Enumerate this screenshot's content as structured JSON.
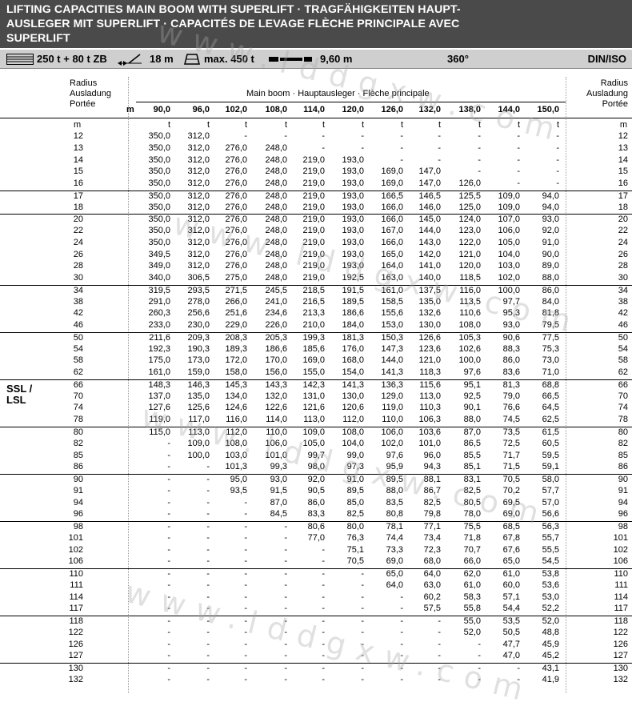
{
  "title": {
    "line1": "LIFTING CAPACITIES MAIN BOOM WITH SUPERLIFT · TRAGFÄHIGKEITEN HAUPT-",
    "line2": "AUSLEGER MIT SUPERLIFT · CAPACITÉS DE LEVAGE FLÈCHE PRINCIPALE AVEC",
    "line3": "SUPERLIFT"
  },
  "specs": {
    "counterweight": "250 t + 80 t ZB",
    "radius": "18 m",
    "max_load": "max. 450 t",
    "track": "9,60 m",
    "slew": "360°",
    "norm": "DIN/ISO"
  },
  "icons": [
    "counterweight-icon",
    "radius-icon",
    "hook-load-icon",
    "track-width-icon"
  ],
  "header": {
    "radius_left": [
      "Radius",
      "Ausladung",
      "Portée"
    ],
    "radius_right": [
      "Radius",
      "Ausladung",
      "Portée"
    ],
    "boom_label": "Main boom · Hauptausleger · Flèche principale",
    "m_label": "m",
    "unit_m": "m",
    "unit_t": "t"
  },
  "side_label": [
    "SSL /",
    "LSL"
  ],
  "columns": [
    "90,0",
    "96,0",
    "102,0",
    "108,0",
    "114,0",
    "120,0",
    "126,0",
    "132,0",
    "138,0",
    "144,0",
    "150,0"
  ],
  "rows": [
    {
      "r": "12",
      "v": [
        "350,0",
        "312,0",
        "-",
        "-",
        "-",
        "-",
        "-",
        "-",
        "-",
        "-",
        "-"
      ]
    },
    {
      "r": "13",
      "v": [
        "350,0",
        "312,0",
        "276,0",
        "248,0",
        "-",
        "-",
        "-",
        "-",
        "-",
        "-",
        "-"
      ]
    },
    {
      "r": "14",
      "v": [
        "350,0",
        "312,0",
        "276,0",
        "248,0",
        "219,0",
        "193,0",
        "-",
        "-",
        "-",
        "-",
        "-"
      ]
    },
    {
      "r": "15",
      "v": [
        "350,0",
        "312,0",
        "276,0",
        "248,0",
        "219,0",
        "193,0",
        "169,0",
        "147,0",
        "-",
        "-",
        "-"
      ]
    },
    {
      "r": "16",
      "v": [
        "350,0",
        "312,0",
        "276,0",
        "248,0",
        "219,0",
        "193,0",
        "169,0",
        "147,0",
        "126,0",
        "-",
        "-"
      ]
    },
    {
      "r": "17",
      "v": [
        "350,0",
        "312,0",
        "276,0",
        "248,0",
        "219,0",
        "193,0",
        "166,5",
        "146,5",
        "125,5",
        "109,0",
        "94,0"
      ]
    },
    {
      "r": "18",
      "v": [
        "350,0",
        "312,0",
        "276,0",
        "248,0",
        "219,0",
        "193,0",
        "166,0",
        "146,0",
        "125,0",
        "109,0",
        "94,0"
      ]
    },
    {
      "r": "20",
      "v": [
        "350,0",
        "312,0",
        "276,0",
        "248,0",
        "219,0",
        "193,0",
        "166,0",
        "145,0",
        "124,0",
        "107,0",
        "93,0"
      ]
    },
    {
      "r": "22",
      "v": [
        "350,0",
        "312,0",
        "276,0",
        "248,0",
        "219,0",
        "193,0",
        "167,0",
        "144,0",
        "123,0",
        "106,0",
        "92,0"
      ]
    },
    {
      "r": "24",
      "v": [
        "350,0",
        "312,0",
        "276,0",
        "248,0",
        "219,0",
        "193,0",
        "166,0",
        "143,0",
        "122,0",
        "105,0",
        "91,0"
      ]
    },
    {
      "r": "26",
      "v": [
        "349,5",
        "312,0",
        "276,0",
        "248,0",
        "219,0",
        "193,0",
        "165,0",
        "142,0",
        "121,0",
        "104,0",
        "90,0"
      ]
    },
    {
      "r": "28",
      "v": [
        "349,0",
        "312,0",
        "276,0",
        "248,0",
        "219,0",
        "193,0",
        "164,0",
        "141,0",
        "120,0",
        "103,0",
        "89,0"
      ]
    },
    {
      "r": "30",
      "v": [
        "340,0",
        "306,5",
        "275,0",
        "248,0",
        "219,0",
        "192,5",
        "163,0",
        "140,0",
        "118,5",
        "102,0",
        "88,0"
      ]
    },
    {
      "r": "34",
      "v": [
        "319,5",
        "293,5",
        "271,5",
        "245,5",
        "218,5",
        "191,5",
        "161,0",
        "137,5",
        "116,0",
        "100,0",
        "86,0"
      ]
    },
    {
      "r": "38",
      "v": [
        "291,0",
        "278,0",
        "266,0",
        "241,0",
        "216,5",
        "189,5",
        "158,5",
        "135,0",
        "113,5",
        "97,7",
        "84,0"
      ]
    },
    {
      "r": "42",
      "v": [
        "260,3",
        "256,6",
        "251,6",
        "234,6",
        "213,3",
        "186,6",
        "155,6",
        "132,6",
        "110,6",
        "95,3",
        "81,8"
      ]
    },
    {
      "r": "46",
      "v": [
        "233,0",
        "230,0",
        "229,0",
        "226,0",
        "210,0",
        "184,0",
        "153,0",
        "130,0",
        "108,0",
        "93,0",
        "79,5"
      ]
    },
    {
      "r": "50",
      "v": [
        "211,6",
        "209,3",
        "208,3",
        "205,3",
        "199,3",
        "181,3",
        "150,3",
        "126,6",
        "105,3",
        "90,6",
        "77,5"
      ]
    },
    {
      "r": "54",
      "v": [
        "192,3",
        "190,3",
        "189,3",
        "186,6",
        "185,6",
        "176,0",
        "147,3",
        "123,6",
        "102,6",
        "88,3",
        "75,3"
      ]
    },
    {
      "r": "58",
      "v": [
        "175,0",
        "173,0",
        "172,0",
        "170,0",
        "169,0",
        "168,0",
        "144,0",
        "121,0",
        "100,0",
        "86,0",
        "73,0"
      ]
    },
    {
      "r": "62",
      "v": [
        "161,0",
        "159,0",
        "158,0",
        "156,0",
        "155,0",
        "154,0",
        "141,3",
        "118,3",
        "97,6",
        "83,6",
        "71,0"
      ]
    },
    {
      "r": "66",
      "v": [
        "148,3",
        "146,3",
        "145,3",
        "143,3",
        "142,3",
        "141,3",
        "136,3",
        "115,6",
        "95,1",
        "81,3",
        "68,8"
      ]
    },
    {
      "r": "70",
      "v": [
        "137,0",
        "135,0",
        "134,0",
        "132,0",
        "131,0",
        "130,0",
        "129,0",
        "113,0",
        "92,5",
        "79,0",
        "66,5"
      ]
    },
    {
      "r": "74",
      "v": [
        "127,6",
        "125,6",
        "124,6",
        "122,6",
        "121,6",
        "120,6",
        "119,0",
        "110,3",
        "90,1",
        "76,6",
        "64,5"
      ]
    },
    {
      "r": "78",
      "v": [
        "119,0",
        "117,0",
        "116,0",
        "114,0",
        "113,0",
        "112,0",
        "110,0",
        "106,3",
        "88,0",
        "74,5",
        "62,5"
      ]
    },
    {
      "r": "80",
      "v": [
        "115,0",
        "113,0",
        "112,0",
        "110,0",
        "109,0",
        "108,0",
        "106,0",
        "103,6",
        "87,0",
        "73,5",
        "61,5"
      ]
    },
    {
      "r": "82",
      "v": [
        "-",
        "109,0",
        "108,0",
        "106,0",
        "105,0",
        "104,0",
        "102,0",
        "101,0",
        "86,5",
        "72,5",
        "60,5"
      ]
    },
    {
      "r": "85",
      "v": [
        "-",
        "100,0",
        "103,0",
        "101,0",
        "99,7",
        "99,0",
        "97,6",
        "96,0",
        "85,5",
        "71,7",
        "59,5"
      ]
    },
    {
      "r": "86",
      "v": [
        "-",
        "-",
        "101,3",
        "99,3",
        "98,0",
        "97,3",
        "95,9",
        "94,3",
        "85,1",
        "71,5",
        "59,1"
      ]
    },
    {
      "r": "90",
      "v": [
        "-",
        "-",
        "95,0",
        "93,0",
        "92,0",
        "91,0",
        "89,5",
        "88,1",
        "83,1",
        "70,5",
        "58,0"
      ]
    },
    {
      "r": "91",
      "v": [
        "-",
        "-",
        "93,5",
        "91,5",
        "90,5",
        "89,5",
        "88,0",
        "86,7",
        "82,5",
        "70,2",
        "57,7"
      ]
    },
    {
      "r": "94",
      "v": [
        "-",
        "-",
        "-",
        "87,0",
        "86,0",
        "85,0",
        "83,5",
        "82,5",
        "80,5",
        "69,5",
        "57,0"
      ]
    },
    {
      "r": "96",
      "v": [
        "-",
        "-",
        "-",
        "84,5",
        "83,3",
        "82,5",
        "80,8",
        "79,8",
        "78,0",
        "69,0",
        "56,6"
      ]
    },
    {
      "r": "98",
      "v": [
        "-",
        "-",
        "-",
        "-",
        "80,6",
        "80,0",
        "78,1",
        "77,1",
        "75,5",
        "68,5",
        "56,3"
      ]
    },
    {
      "r": "101",
      "v": [
        "-",
        "-",
        "-",
        "-",
        "77,0",
        "76,3",
        "74,4",
        "73,4",
        "71,8",
        "67,8",
        "55,7"
      ]
    },
    {
      "r": "102",
      "v": [
        "-",
        "-",
        "-",
        "-",
        "-",
        "75,1",
        "73,3",
        "72,3",
        "70,7",
        "67,6",
        "55,5"
      ]
    },
    {
      "r": "106",
      "v": [
        "-",
        "-",
        "-",
        "-",
        "-",
        "70,5",
        "69,0",
        "68,0",
        "66,0",
        "65,0",
        "54,5"
      ]
    },
    {
      "r": "110",
      "v": [
        "-",
        "-",
        "-",
        "-",
        "-",
        "-",
        "65,0",
        "64,0",
        "62,0",
        "61,0",
        "53,8"
      ]
    },
    {
      "r": "111",
      "v": [
        "-",
        "-",
        "-",
        "-",
        "-",
        "-",
        "64,0",
        "63,0",
        "61,0",
        "60,0",
        "53,6"
      ]
    },
    {
      "r": "114",
      "v": [
        "-",
        "-",
        "-",
        "-",
        "-",
        "-",
        "-",
        "60,2",
        "58,3",
        "57,1",
        "53,0"
      ]
    },
    {
      "r": "117",
      "v": [
        "-",
        "-",
        "-",
        "-",
        "-",
        "-",
        "-",
        "57,5",
        "55,8",
        "54,4",
        "52,2"
      ]
    },
    {
      "r": "118",
      "v": [
        "-",
        "-",
        "-",
        "-",
        "-",
        "-",
        "-",
        "-",
        "55,0",
        "53,5",
        "52,0"
      ]
    },
    {
      "r": "122",
      "v": [
        "-",
        "-",
        "-",
        "-",
        "-",
        "-",
        "-",
        "-",
        "52,0",
        "50,5",
        "48,8"
      ]
    },
    {
      "r": "126",
      "v": [
        "-",
        "-",
        "-",
        "-",
        "-",
        "-",
        "-",
        "-",
        "-",
        "47,7",
        "45,9"
      ]
    },
    {
      "r": "127",
      "v": [
        "-",
        "-",
        "-",
        "-",
        "-",
        "-",
        "-",
        "-",
        "-",
        "47,0",
        "45,2"
      ]
    },
    {
      "r": "130",
      "v": [
        "-",
        "-",
        "-",
        "-",
        "-",
        "-",
        "-",
        "-",
        "-",
        "-",
        "43,1"
      ]
    },
    {
      "r": "132",
      "v": [
        "-",
        "-",
        "-",
        "-",
        "-",
        "-",
        "-",
        "-",
        "-",
        "-",
        "41,9"
      ]
    }
  ],
  "watermark": "www.lddgxw.com"
}
